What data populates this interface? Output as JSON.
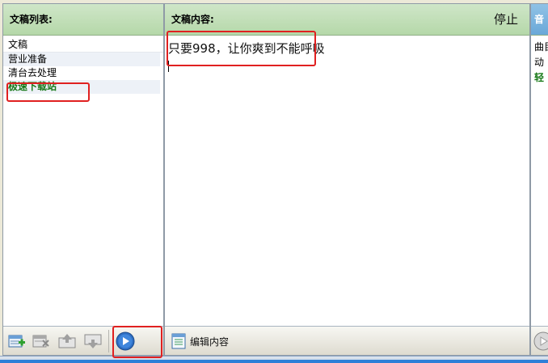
{
  "list_pane": {
    "title": "文稿列表:",
    "column_header": "文稿",
    "items": [
      {
        "label": "营业准备"
      },
      {
        "label": "清台去处理"
      },
      {
        "label": "极速下载站"
      }
    ]
  },
  "content_pane": {
    "title": "文稿内容:",
    "stop_label": "停止",
    "text": "只要998，让你爽到不能呼吸",
    "edit_label": "编辑内容"
  },
  "music_pane": {
    "title": "音",
    "lines": [
      "曲目",
      "动",
      "轻"
    ]
  },
  "colors": {
    "header_green": "#b5d8a9",
    "music_header_blue": "#6aa8d8",
    "active_item_green": "#1a7a1a",
    "annotation_red": "#e02020"
  },
  "icons": [
    "add-doc-icon",
    "delete-doc-icon",
    "move-up-icon",
    "move-down-icon",
    "play-icon",
    "edit-doc-icon"
  ]
}
